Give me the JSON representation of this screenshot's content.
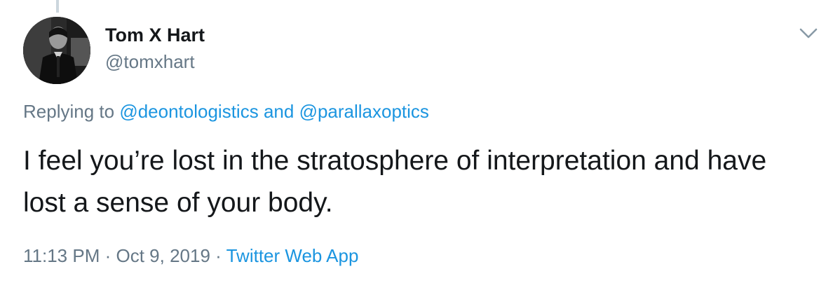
{
  "tweet": {
    "author": {
      "name": "Tom X Hart",
      "handle": "@tomxhart"
    },
    "replying_to": {
      "prefix": "Replying to",
      "mention_1": "@deontologistics",
      "conjunction": "and",
      "mention_2": "@parallaxoptics"
    },
    "text": "I feel you’re lost in the stratosphere of interpretation and have lost a sense of your body.",
    "meta": {
      "time": "11:13 PM",
      "separator": "·",
      "date": "Oct 9, 2019",
      "source": "Twitter Web App"
    },
    "icons": {
      "menu": "chevron-down-icon"
    },
    "colors": {
      "link": "#1b95e0",
      "secondary_text": "#657786",
      "primary_text": "#14171a"
    }
  }
}
